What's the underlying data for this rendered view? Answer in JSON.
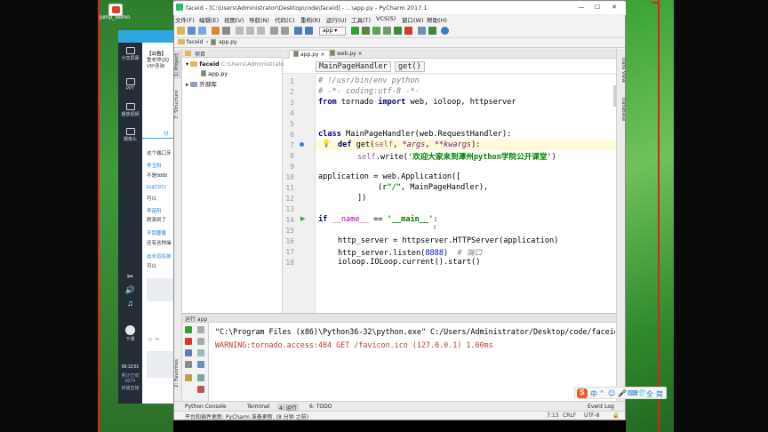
{
  "desktop": {
    "icon_label": "jump_demo"
  },
  "chat": {
    "sidebar": [
      "分享屏幕",
      "PPT",
      "播放视频",
      "摄像头"
    ],
    "notice_title": "【公告】",
    "notice_lines": [
      "重老师QQ",
      "VIP咨询"
    ],
    "tab": "讨",
    "messages": [
      "这个端口牙",
      "李玉阳",
      "不是8888",
      "Du[CDCr",
      "可以",
      "李苗阳",
      "刚清到了",
      "不锁蔓蔓",
      "还有这种操",
      "@永远往前",
      "可以"
    ],
    "speaker": "下课",
    "time": "06:12:01",
    "footer": [
      "累计已有",
      "8274",
      "转播直播"
    ]
  },
  "ide": {
    "title": "faceid - [C:\\Users\\Administrator\\Desktop\\code\\faceid] - ...\\app.py - PyCharm 2017.1",
    "menu": [
      "文件(F)",
      "编辑(E)",
      "视图(V)",
      "导航(N)",
      "代码(C)",
      "重构(R)",
      "运行(U)",
      "工具(T)",
      "VCS(S)",
      "窗口(W)",
      "帮助(H)"
    ],
    "run_config": "app",
    "nav": {
      "project": "faceid",
      "file": "app.py"
    },
    "left_tabs": [
      "1: Project",
      "7: Structure",
      "2: Favorites"
    ],
    "right_tabs": [
      "Data View",
      "Database"
    ],
    "project_header": "项目",
    "tree": {
      "root": "faceid",
      "root_path": "C:\\Users\\Administrator\\",
      "file": "app.py",
      "external": "外部库"
    },
    "tabs": [
      "app.py",
      "web.py"
    ],
    "breadcrumb": [
      "MainPageHandler",
      "get()"
    ],
    "line_numbers": [
      "1",
      "2",
      "3",
      "4",
      "5",
      "6",
      "7",
      "8",
      "9",
      "10",
      "11",
      "12",
      "13",
      "14",
      "15",
      "16",
      "17",
      "18"
    ],
    "code": {
      "l1": "# !/usr/bin/env python",
      "l2": "# -*- coding:utf-8 -*-",
      "l3_kw": "from",
      "l3_mod": " tornado ",
      "l3_kw2": "import",
      "l3_rest": " web, ioloop, httpserver",
      "l6_kw": "class",
      "l6_name": " MainPageHandler",
      "l6_rest": "(web.RequestHandler):",
      "l7_kw": "def",
      "l7_fn": " get",
      "l7_p1": "(",
      "l7_self": "self",
      "l7_p2": ", ",
      "l7_args": "*args",
      "l7_p3": ", ",
      "l7_kwargs": "**kwargs",
      "l7_p4": "):",
      "l8_self": "self",
      "l8_call": ".write(",
      "l8_str": "'欢迎大家来到潭州python学院公开课堂'",
      "l8_end": ")",
      "l10": "application = web.Application([",
      "l11_a": "(",
      "l11_str": "r\"/\"",
      "l11_b": ", MainPageHandler),",
      "l12": "])",
      "l14_kw": "if",
      "l14_name": " __name__ ",
      "l14_op": "== ",
      "l14_str": "'__main__'",
      "l14_end": ":",
      "l16": "http_server = httpserver.HTTPServer(application)",
      "l17_a": "http_server.listen(",
      "l17_num": "8888",
      "l17_b": ")  ",
      "l17_cmt": "# 端口",
      "l18": "ioloop.IOLoop.current().start()"
    },
    "run": {
      "header": "运行 app",
      "line1": "\"C:\\Program Files (x86)\\Python36-32\\python.exe\" C:/Users/Administrator/Desktop/code/faceid",
      "line2": "WARNING:tornado.access:404 GET /favicon.ico (127.0.0.1) 1.00ms"
    },
    "bottom_tabs": [
      "Python Console",
      "Terminal",
      "4: 运行",
      "6: TODO"
    ],
    "event_log": "Event Log",
    "status": {
      "message": "平台和插件更新: PyCharm 准备更新. (8 分钟 之前)",
      "position": "7:13",
      "line_sep": "CRLF",
      "encoding": "UTF-8"
    }
  },
  "ime": {
    "logo": "S",
    "glyphs": [
      "中",
      "°",
      "☺",
      "🎤",
      "⌨",
      "👕",
      "全",
      "简"
    ]
  },
  "colors": {
    "accent": "#2ea7e0",
    "border_red": "#e0201c",
    "string": "#008000",
    "keyword": "#000080",
    "warning": "#c0392b"
  }
}
